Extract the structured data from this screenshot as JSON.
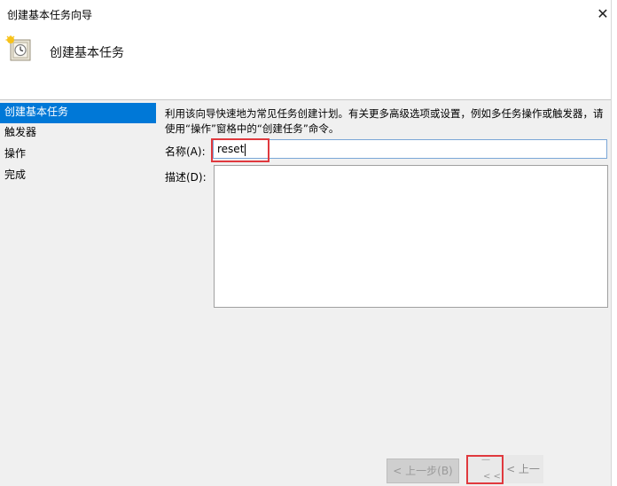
{
  "window": {
    "title": "创建基本任务向导",
    "close_glyph": "✕"
  },
  "header": {
    "title": "创建基本任务",
    "icon": "task-scheduler-clock-icon"
  },
  "steps": [
    {
      "label": "创建基本任务",
      "active": true
    },
    {
      "label": "触发器",
      "active": false
    },
    {
      "label": "操作",
      "active": false
    },
    {
      "label": "完成",
      "active": false
    }
  ],
  "main": {
    "description": "利用该向导快速地为常见任务创建计划。有关更多高级选项或设置，例如多任务操作或触发器，请使用“操作”窗格中的“创建任务”命令。",
    "name_label": "名称(A):",
    "name_value": "reset",
    "desc_label": "描述(D):",
    "desc_value": ""
  },
  "buttons": {
    "back": "< 上一步(B)",
    "next_fragment": "< <",
    "ghost_back": "< 上一"
  },
  "colors": {
    "accent": "#0078d7",
    "highlight_box": "#e0393e"
  }
}
